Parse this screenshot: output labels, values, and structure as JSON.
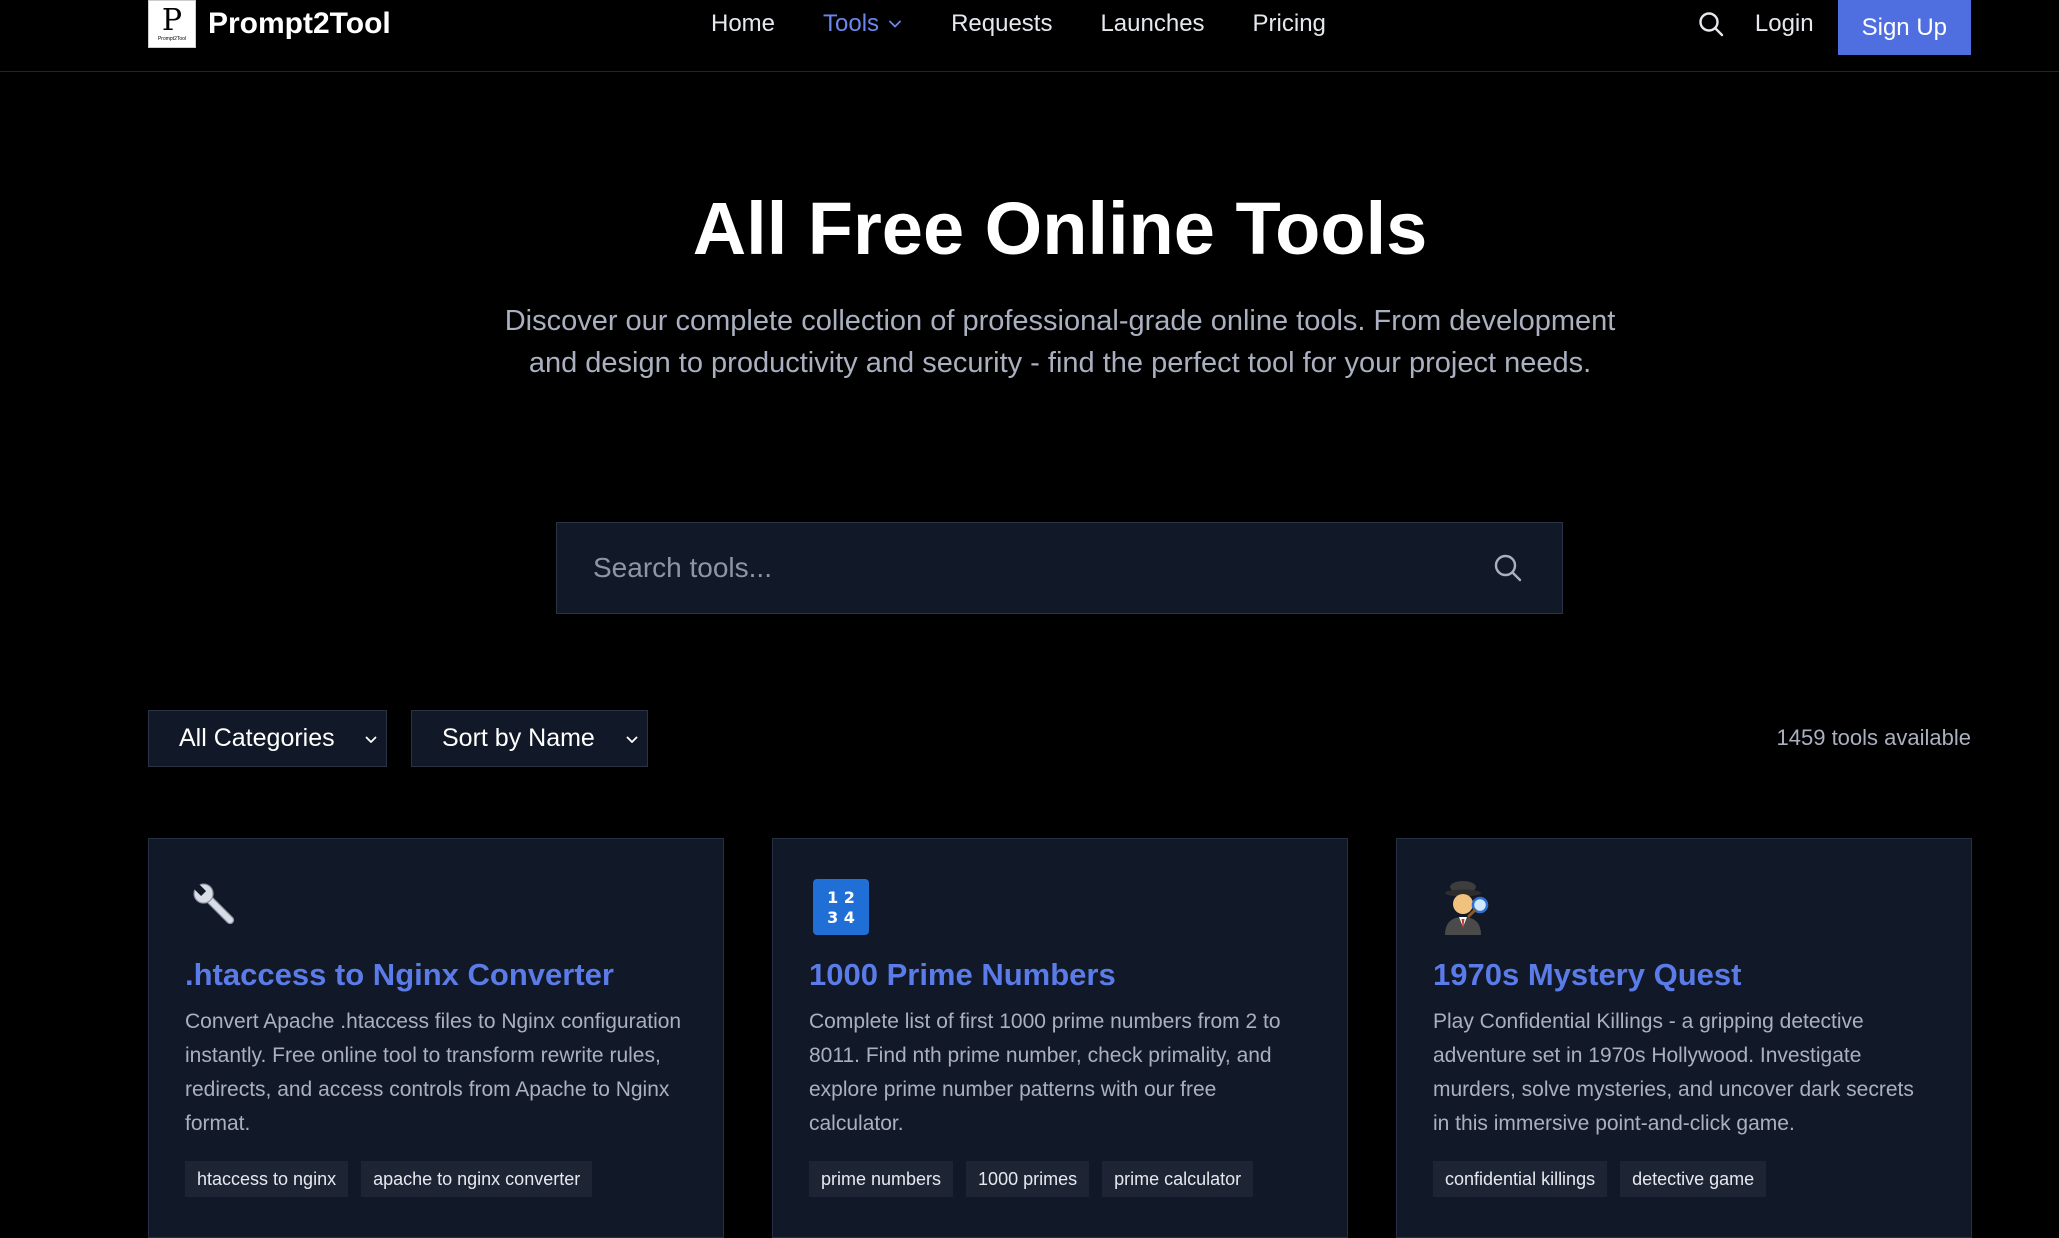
{
  "nav": {
    "logo_text": "Prompt2Tool",
    "logo_mark_letter": "P",
    "logo_mark_caption": "Prompt2Tool",
    "links": [
      "Home",
      "Tools",
      "Requests",
      "Launches",
      "Pricing"
    ],
    "active_link": "Tools",
    "login": "Login",
    "signup": "Sign Up"
  },
  "hero": {
    "title": "All Free Online Tools",
    "subtitle": "Discover our complete collection of professional-grade online tools. From development and design to productivity and security - find the perfect tool for your project needs."
  },
  "search": {
    "placeholder": "Search tools..."
  },
  "filters": {
    "category": "All Categories",
    "sort": "Sort by Name",
    "count_text": "1459 tools available"
  },
  "cards": [
    {
      "icon": "wrench-icon",
      "title": ".htaccess to Nginx Converter",
      "description": "Convert Apache .htaccess files to Nginx configuration instantly. Free online tool to transform rewrite rules, redirects, and access controls from Apache to Nginx format.",
      "tags": [
        "htaccess to nginx",
        "apache to nginx converter"
      ]
    },
    {
      "icon": "numbers-icon",
      "icon_digits": [
        "1 2",
        "3 4"
      ],
      "title": "1000 Prime Numbers",
      "description": "Complete list of first 1000 prime numbers from 2 to 8011. Find nth prime number, check primality, and explore prime number patterns with our free calculator.",
      "tags": [
        "prime numbers",
        "1000 primes",
        "prime calculator"
      ]
    },
    {
      "icon": "detective-icon",
      "title": "1970s Mystery Quest",
      "description": "Play Confidential Killings - a gripping detective adventure set in 1970s Hollywood. Investigate murders, solve mysteries, and uncover dark secrets in this immersive point-and-click game.",
      "tags": [
        "confidential killings",
        "detective game"
      ]
    }
  ],
  "colors": {
    "background": "#000000",
    "card_background": "#111827",
    "accent": "#4f6fe0",
    "title_link": "#5b7be8",
    "muted_text": "#aab0bf"
  }
}
